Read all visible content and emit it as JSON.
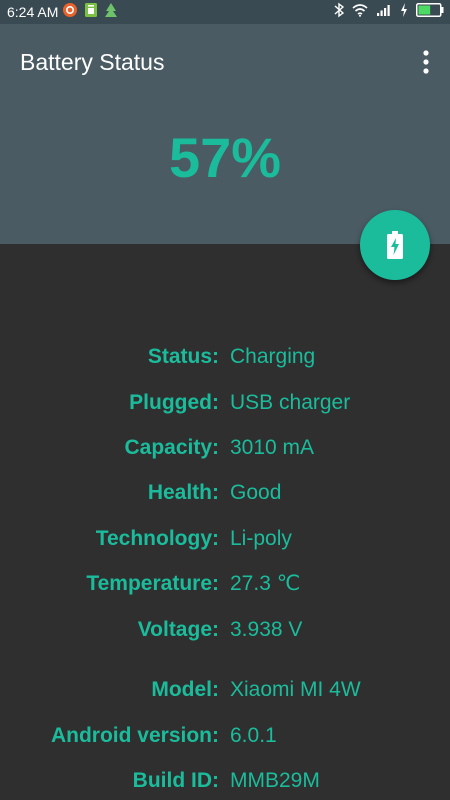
{
  "status_bar": {
    "time": "6:24 AM",
    "left_icons": [
      "app-notification-icon",
      "sim-icon",
      "tree-icon"
    ],
    "right_icons": [
      "bluetooth-icon",
      "wifi-icon",
      "signal-icon",
      "charging-icon",
      "battery-icon"
    ],
    "battery_level": 0.57
  },
  "app": {
    "title": "Battery Status",
    "percent": "57%",
    "accent_color": "#1abc9c",
    "header_color": "#4a5b63",
    "background_color": "#2f2f2f"
  },
  "info": {
    "status": {
      "label": "Status:",
      "value": "Charging"
    },
    "plugged": {
      "label": "Plugged:",
      "value": "USB charger"
    },
    "capacity": {
      "label": "Capacity:",
      "value": "3010 mA"
    },
    "health": {
      "label": "Health:",
      "value": "Good"
    },
    "technology": {
      "label": "Technology:",
      "value": "Li-poly"
    },
    "temperature": {
      "label": "Temperature:",
      "value": "27.3 ℃"
    },
    "voltage": {
      "label": "Voltage:",
      "value": "3.938 V"
    },
    "model": {
      "label": "Model:",
      "value": "Xiaomi MI 4W"
    },
    "android": {
      "label": "Android version:",
      "value": "6.0.1"
    },
    "build": {
      "label": "Build ID:",
      "value": "MMB29M"
    }
  }
}
